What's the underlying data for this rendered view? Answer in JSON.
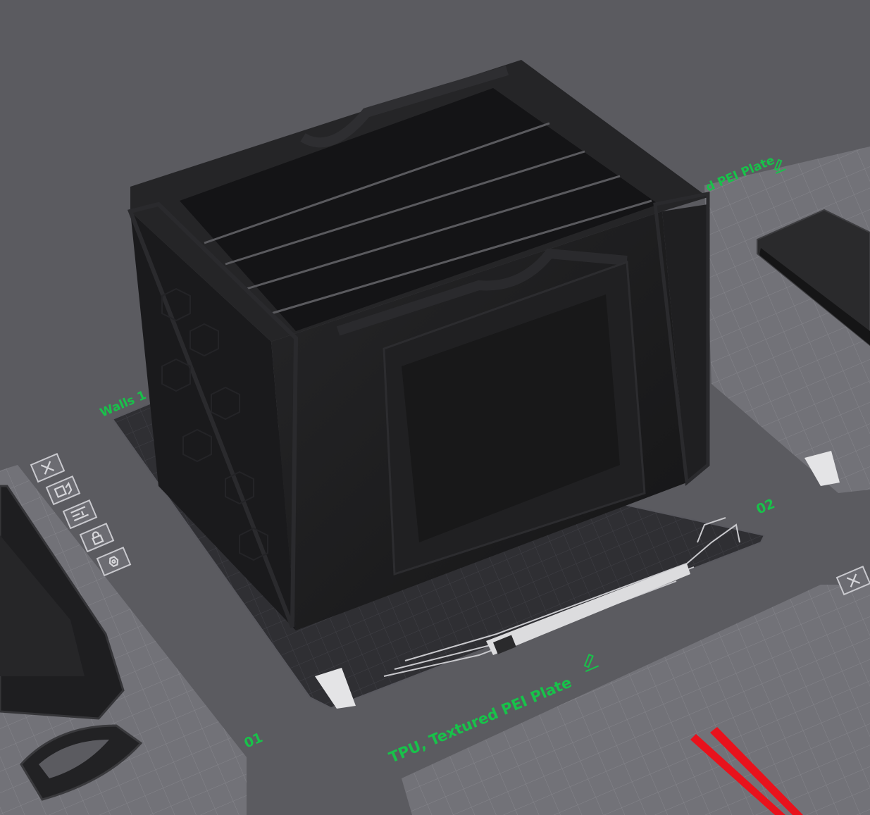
{
  "app": {
    "view": "3D plate viewport"
  },
  "plates": [
    {
      "id": "01",
      "number_label": "01",
      "filament_and_plate_label": "",
      "state": "partial-left"
    },
    {
      "id": "02",
      "number_label": "02",
      "filament_and_plate_label": "Walls 1",
      "state": "active"
    },
    {
      "id": "03",
      "number_label": "",
      "filament_and_plate_label": "d PEI Plate",
      "state": "partial-right"
    },
    {
      "id": "04",
      "number_label": "",
      "filament_and_plate_label": "TPU, Textured PEI Plate",
      "state": "partial-bottom"
    }
  ],
  "labels": {
    "walls": "Walls 1",
    "plate_right_top": "d PEI Plate",
    "plate_num_01": "01",
    "plate_num_02": "02",
    "plate_bottom": "TPU, Textured PEI Plate"
  },
  "plate_toolbar": [
    {
      "action": "close",
      "icon": "close-icon"
    },
    {
      "action": "arrange",
      "icon": "arrange-icon"
    },
    {
      "action": "orient",
      "icon": "orient-icon"
    },
    {
      "action": "lock",
      "icon": "lock-icon"
    },
    {
      "action": "settings",
      "icon": "settings-icon"
    }
  ],
  "colors": {
    "background": "#5b5b60",
    "plate_grid": "#74747a",
    "active_plate": "#323236",
    "label_green": "#18c24a",
    "model_dark": "#1c1c1e",
    "model_red": "#e8121c"
  }
}
